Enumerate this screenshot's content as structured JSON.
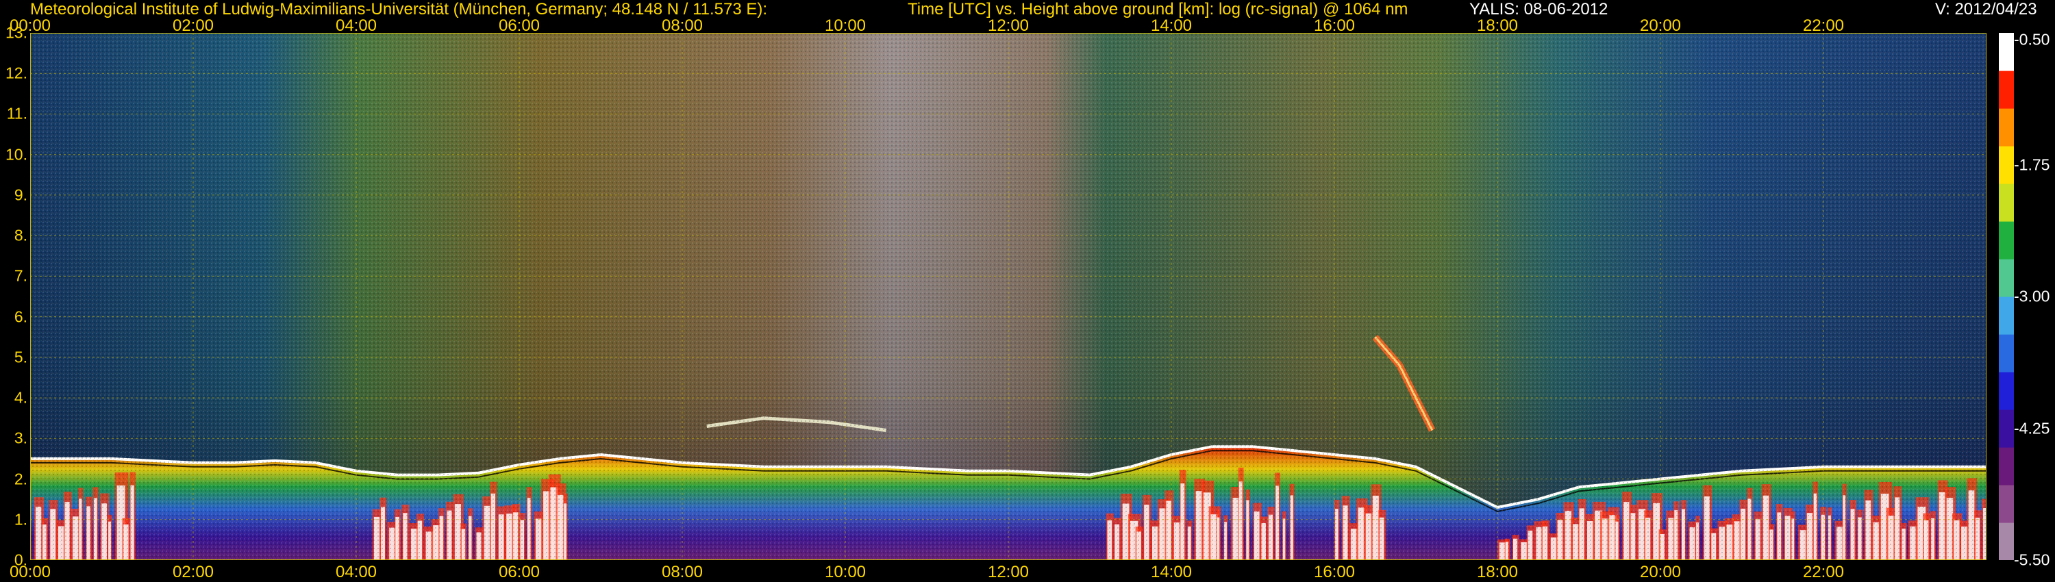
{
  "header": {
    "institute": "Meteorological Institute of Ludwig-Maximilians-Universität (München, Germany; 48.148 N / 11.573 E):",
    "plot_title": "Time [UTC] vs. Height above ground [km]: log (rc-signal) @ 1064 nm",
    "instrument": "YALIS: 08-06-2012",
    "version": "V: 2012/04/23"
  },
  "colors": {
    "text": "#ffd800",
    "grid": "#c8b400",
    "boundary_layer_line": "#ffffff"
  },
  "chart_data": {
    "type": "heatmap",
    "title": "Time [UTC] vs. Height above ground [km]: log (rc-signal) @ 1064 nm",
    "xlabel": "Time [UTC]",
    "ylabel": "Height above ground [km]",
    "x_ticks": [
      "00:00",
      "02:00",
      "04:00",
      "06:00",
      "08:00",
      "10:00",
      "12:00",
      "14:00",
      "16:00",
      "18:00",
      "20:00",
      "22:00"
    ],
    "y_ticks": [
      "0.",
      "1.",
      "2.",
      "3.",
      "4.",
      "5.",
      "6.",
      "7.",
      "8.",
      "9.",
      "10.",
      "11.",
      "12.",
      "13."
    ],
    "xlim": [
      0,
      24
    ],
    "ylim": [
      0,
      13
    ],
    "grid": true,
    "colorbar": {
      "ticks": [
        "-0.50",
        "-1.75",
        "-3.00",
        "-4.25",
        "-5.50"
      ],
      "range": [
        -5.5,
        -0.5
      ],
      "palette": [
        "#a888a8",
        "#8c4a8c",
        "#6a1a7a",
        "#3a10a0",
        "#2020d8",
        "#2a6ae0",
        "#40a8e8",
        "#50c890",
        "#20b040",
        "#c8e020",
        "#ffe000",
        "#ff9000",
        "#ff2000",
        "#ffffff"
      ]
    },
    "boundary_layer_top_km": {
      "time_h": [
        0.0,
        0.5,
        1.0,
        1.5,
        2.0,
        2.5,
        3.0,
        3.5,
        4.0,
        4.5,
        5.0,
        5.5,
        6.0,
        6.5,
        7.0,
        7.5,
        8.0,
        8.5,
        9.0,
        9.5,
        10.0,
        10.5,
        11.0,
        11.5,
        12.0,
        12.5,
        13.0,
        13.5,
        14.0,
        14.5,
        15.0,
        15.5,
        16.0,
        16.5,
        17.0,
        17.5,
        18.0,
        18.5,
        19.0,
        19.5,
        20.0,
        20.5,
        21.0,
        21.5,
        22.0,
        22.5,
        23.0,
        23.5,
        24.0
      ],
      "height_km": [
        2.5,
        2.5,
        2.5,
        2.45,
        2.4,
        2.4,
        2.45,
        2.4,
        2.2,
        2.1,
        2.1,
        2.15,
        2.35,
        2.5,
        2.6,
        2.5,
        2.4,
        2.35,
        2.3,
        2.3,
        2.3,
        2.3,
        2.25,
        2.2,
        2.2,
        2.15,
        2.1,
        2.3,
        2.6,
        2.8,
        2.8,
        2.7,
        2.6,
        2.5,
        2.3,
        1.8,
        1.3,
        1.5,
        1.8,
        1.9,
        2.0,
        2.1,
        2.2,
        2.25,
        2.3,
        2.3,
        2.3,
        2.3,
        2.3
      ]
    },
    "aerosol_layer_km": {
      "time_h": [
        8.3,
        9.0,
        9.8,
        10.5
      ],
      "height_km": [
        3.3,
        3.5,
        3.4,
        3.2
      ]
    },
    "plume_feature_km": {
      "time_h": [
        16.5,
        16.8,
        17.0,
        17.2
      ],
      "height_km": [
        5.5,
        4.8,
        4.0,
        3.2
      ]
    }
  }
}
